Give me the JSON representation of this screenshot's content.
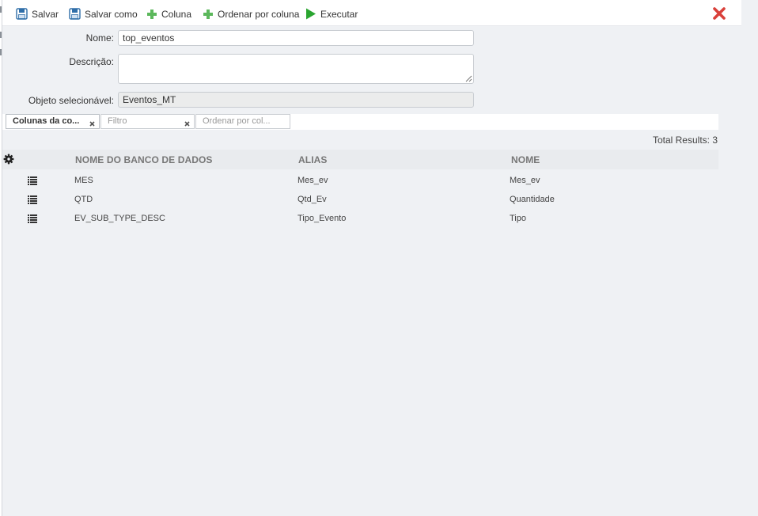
{
  "toolbar": {
    "save_label": "Salvar",
    "save_as_label": "Salvar como",
    "column_label": "Coluna",
    "order_by_label": "Ordenar por coluna",
    "execute_label": "Executar"
  },
  "form": {
    "name_label": "Nome:",
    "name_value": "top_eventos",
    "description_label": "Descrição:",
    "description_value": "",
    "object_label": "Objeto selecionável:",
    "object_value": "Eventos_MT"
  },
  "tabs": {
    "columns_label": "Colunas da co...",
    "filter_placeholder": "Filtro",
    "order_placeholder": "Ordenar por col..."
  },
  "results": {
    "total_label": "Total Results: 3"
  },
  "table": {
    "headers": {
      "db_name": "NOME DO BANCO DE DADOS",
      "alias": "ALIAS",
      "name": "NOME"
    },
    "rows": [
      {
        "db_name": "MES",
        "alias": "Mes_ev",
        "name": "Mes_ev"
      },
      {
        "db_name": "QTD",
        "alias": "Qtd_Ev",
        "name": "Quantidade"
      },
      {
        "db_name": "EV_SUB_TYPE_DESC",
        "alias": "Tipo_Evento",
        "name": "Tipo"
      }
    ]
  },
  "colors": {
    "accent_green": "#5cb85c",
    "execute_green": "#2aa530",
    "close_red": "#d9403a",
    "save_blue": "#2f6ea8"
  }
}
